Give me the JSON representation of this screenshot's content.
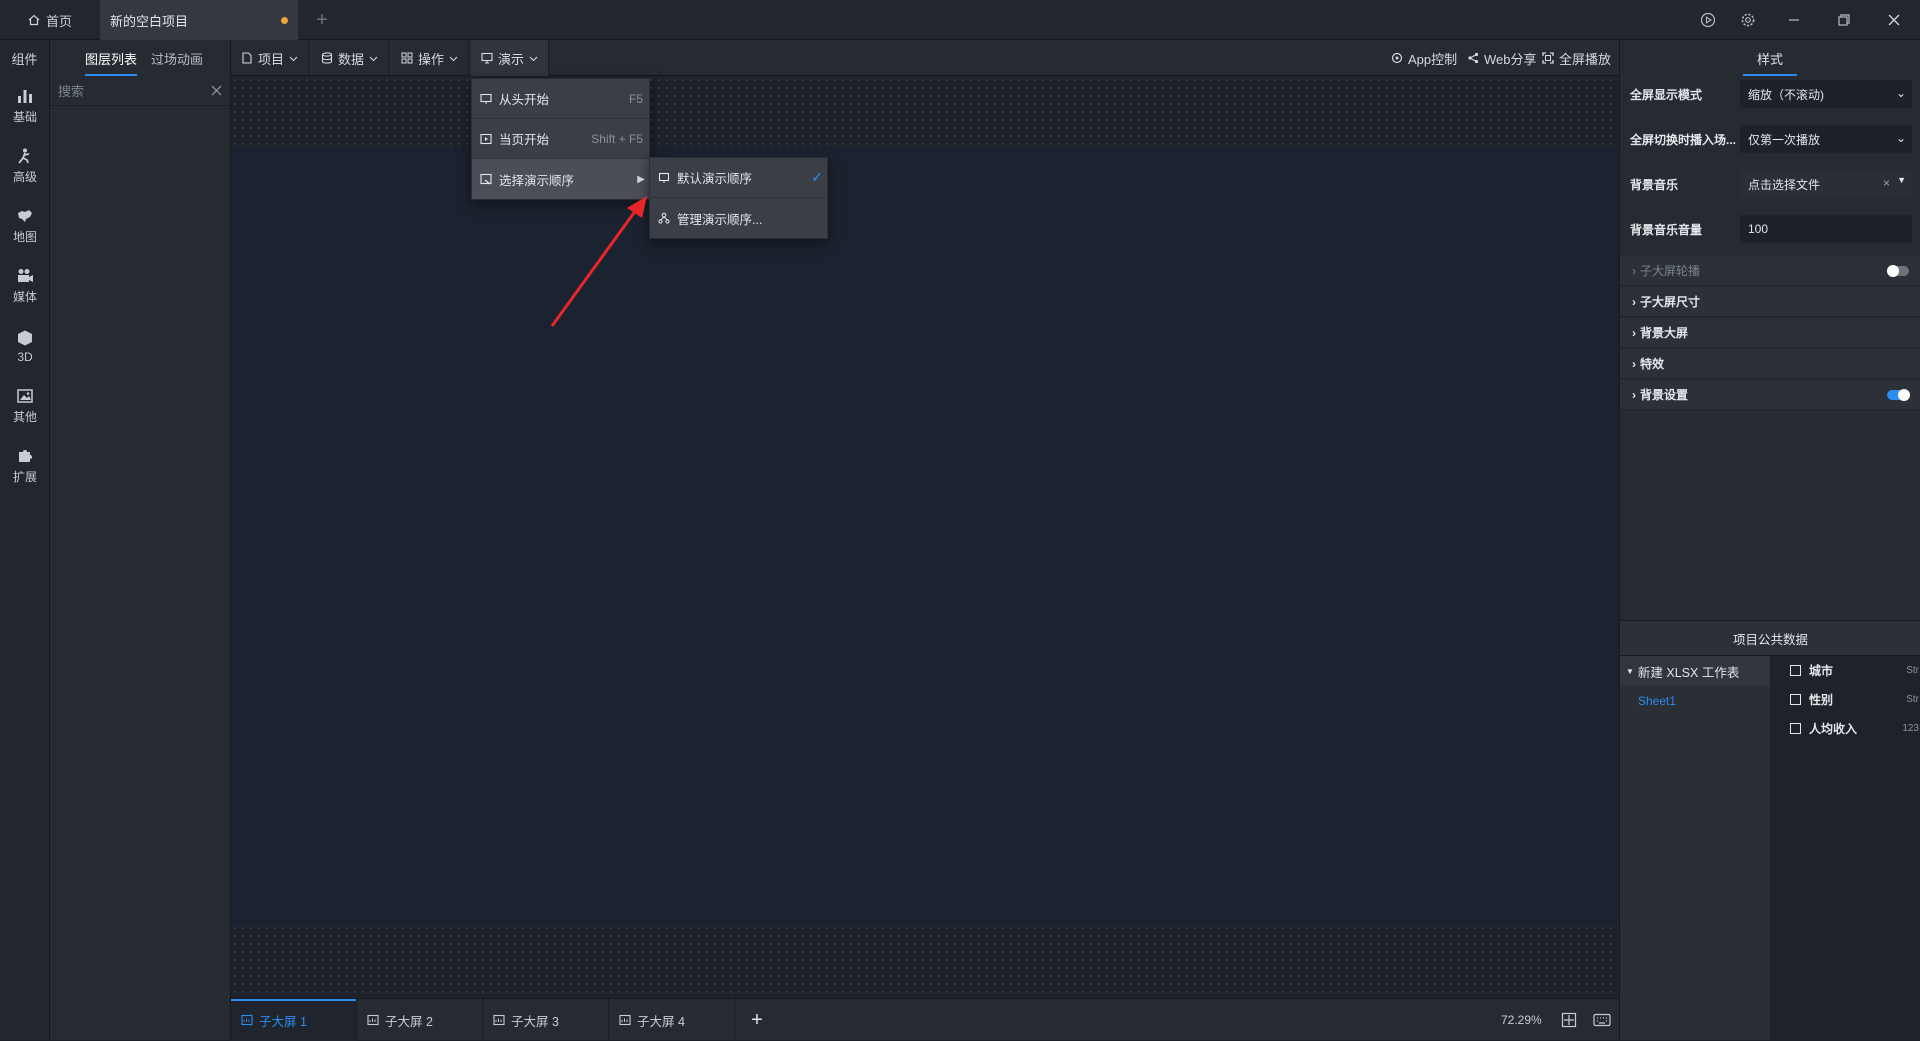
{
  "titlebar": {
    "home_label": "首页",
    "project_tab_label": "新的空白项目",
    "add_tab_label": "+"
  },
  "leftrail": {
    "header": "组件",
    "items": [
      {
        "label": "基础",
        "icon": "bar-chart-icon"
      },
      {
        "label": "高级",
        "icon": "advanced-icon"
      },
      {
        "label": "地图",
        "icon": "map-icon"
      },
      {
        "label": "媒体",
        "icon": "video-camera-icon"
      },
      {
        "label": "3D",
        "icon": "cube-icon"
      },
      {
        "label": "其他",
        "icon": "image-icon"
      },
      {
        "label": "扩展",
        "icon": "puzzle-icon"
      }
    ]
  },
  "layerpanel": {
    "tabs": [
      "图层列表",
      "过场动画"
    ],
    "search_placeholder": "搜索"
  },
  "toolbar": {
    "menus": [
      "项目",
      "数据",
      "操作",
      "演示"
    ],
    "right": [
      "App控制",
      "Web分享",
      "全屏播放"
    ]
  },
  "present_menu": {
    "items": [
      {
        "label": "从头开始",
        "shortcut": "F5"
      },
      {
        "label": "当页开始",
        "shortcut": "Shift + F5"
      },
      {
        "label": "选择演示顺序",
        "shortcut": ""
      }
    ],
    "submenu": [
      {
        "label": "默认演示顺序",
        "checked": true
      },
      {
        "label": "管理演示顺序...",
        "checked": false
      }
    ]
  },
  "bottombar": {
    "screens": [
      "子大屏 1",
      "子大屏 2",
      "子大屏 3",
      "子大屏 4"
    ],
    "add_label": "+",
    "zoom": "72.29%"
  },
  "rightpanel": {
    "tab": "样式",
    "props": [
      {
        "label": "全屏显示模式",
        "value": "缩放（不滚动)"
      },
      {
        "label": "全屏切换时播入场...",
        "value": "仅第一次播放"
      },
      {
        "label": "背景音乐",
        "value": "点击选择文件"
      },
      {
        "label": "背景音乐音量",
        "value": "100"
      }
    ],
    "sections": [
      {
        "label": "子大屏轮播",
        "toggle": "off",
        "disabled": true
      },
      {
        "label": "子大屏尺寸"
      },
      {
        "label": "背景大屏"
      },
      {
        "label": "特效"
      },
      {
        "label": "背景设置",
        "toggle": "on"
      }
    ],
    "public_data": {
      "title": "项目公共数据",
      "file": "新建 XLSX 工作表",
      "sheet": "Sheet1",
      "fields": [
        {
          "name": "城市",
          "type": "Str"
        },
        {
          "name": "性别",
          "type": "Str"
        },
        {
          "name": "人均收入",
          "type": "123"
        }
      ]
    }
  },
  "colors": {
    "accent": "#2d8cf0",
    "annotation_arrow": "#e8252b",
    "unsaved_dot": "#f0a33a"
  }
}
